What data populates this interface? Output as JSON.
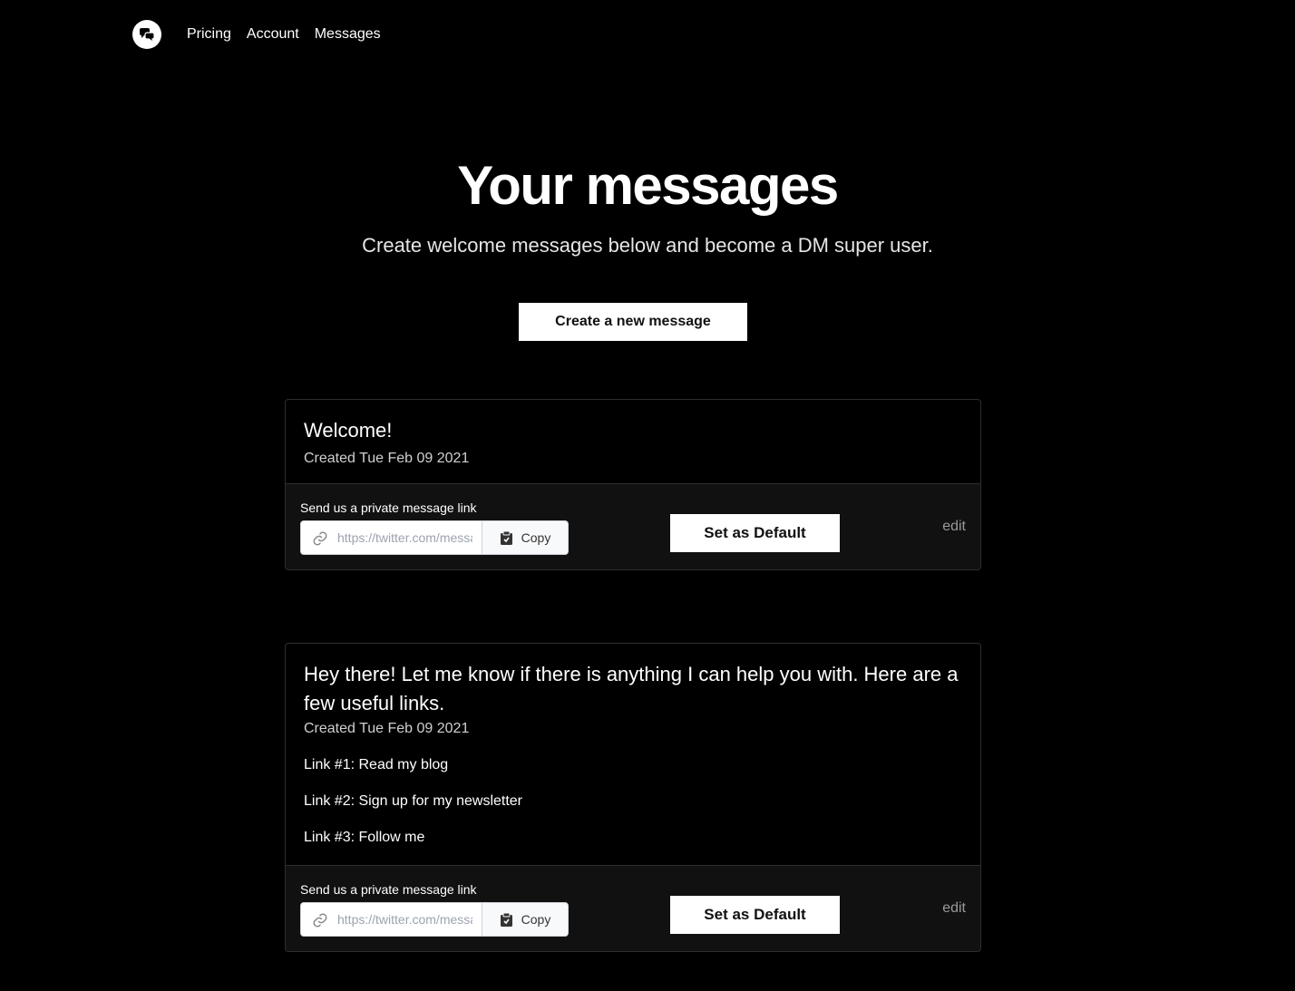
{
  "nav": {
    "logo_icon": "chat-bubbles-icon",
    "links": [
      "Pricing",
      "Account",
      "Messages"
    ]
  },
  "hero": {
    "title": "Your messages",
    "subtitle": "Create welcome messages below and become a DM super user.",
    "create_button": "Create a new message"
  },
  "messages": [
    {
      "title": "Welcome!",
      "created": "Created Tue Feb 09 2021",
      "lines": [],
      "link_label": "Send us a private message link",
      "link_placeholder": "https://twitter.com/messages/compose",
      "copy_label": "Copy",
      "default_label": "Set as Default",
      "edit_label": "edit"
    },
    {
      "title": "Hey there! Let me know if there is anything I can help you with. Here are a few useful links.",
      "created": "Created Tue Feb 09 2021",
      "lines": [
        "Link #1: Read my blog",
        "Link #2: Sign up for my newsletter",
        "Link #3: Follow me"
      ],
      "link_label": "Send us a private message link",
      "link_placeholder": "https://twitter.com/messages/compose",
      "copy_label": "Copy",
      "default_label": "Set as Default",
      "edit_label": "edit"
    }
  ],
  "colors": {
    "background": "#000000",
    "footer_bg": "#111111",
    "button_bg": "#ffffff",
    "muted_text": "#9a9a9a"
  }
}
